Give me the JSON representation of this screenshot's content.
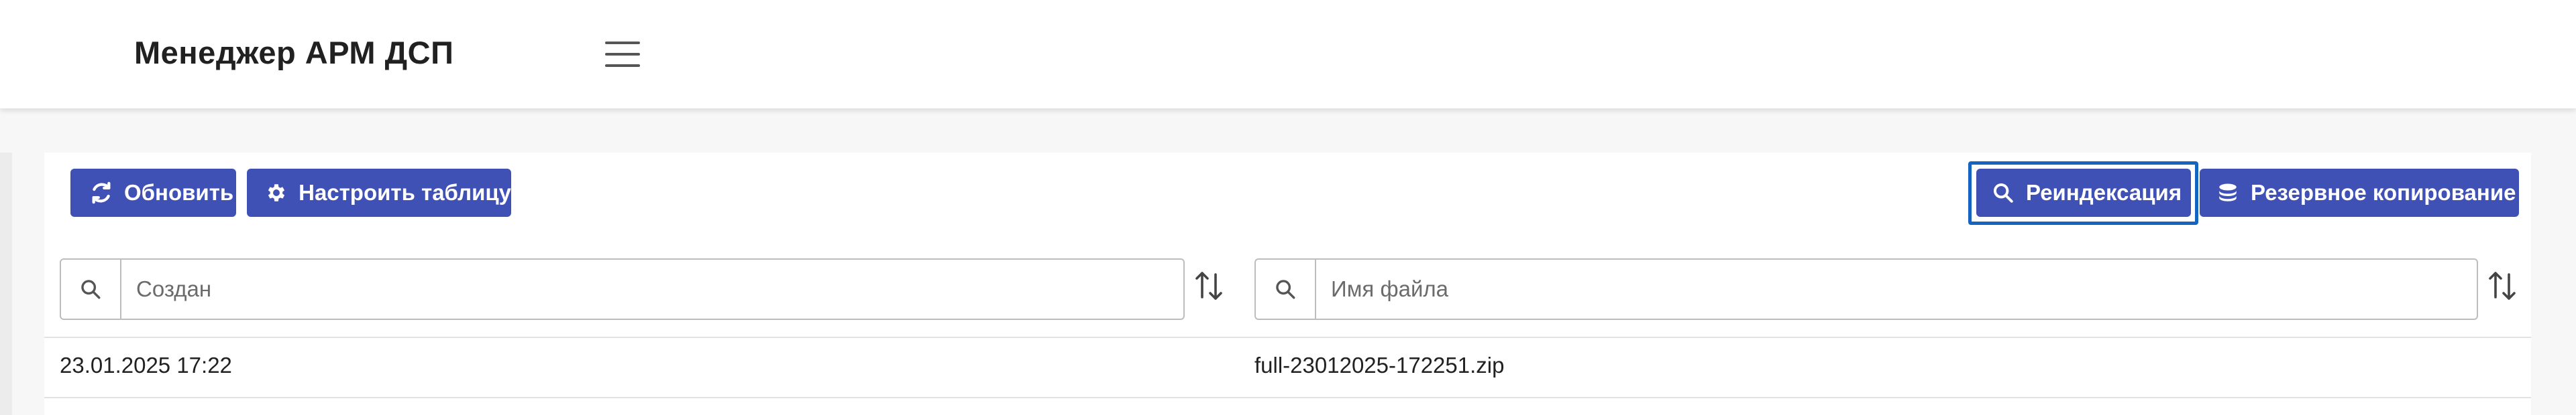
{
  "header": {
    "app_title": "Менеджер АРМ ДСП",
    "menu_icon": "hamburger-menu-icon"
  },
  "toolbar": {
    "refresh_label": "Обновить",
    "refresh_icon": "refresh-icon",
    "configure_label": "Настроить таблицу",
    "configure_icon": "gear-icon",
    "reindex_label": "Реиндексация",
    "reindex_icon": "search-icon",
    "backup_label": "Резервное копирование",
    "backup_icon": "database-icon"
  },
  "filters": {
    "created_placeholder": "Создан",
    "created_value": "",
    "filename_placeholder": "Имя файла",
    "filename_value": ""
  },
  "table": {
    "rows": [
      {
        "created": "23.01.2025 17:22",
        "filename": "full-23012025-172251.zip"
      }
    ]
  },
  "colors": {
    "primary": "#3f51b5",
    "focus": "#1565c0",
    "background": "#f7f7f7"
  }
}
